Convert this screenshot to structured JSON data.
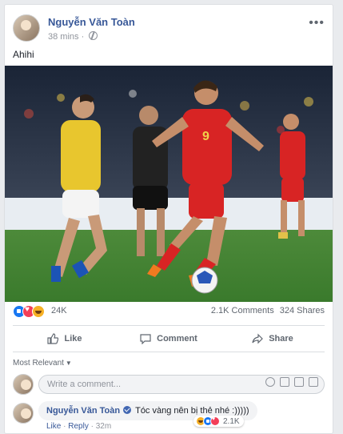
{
  "post": {
    "author": "Nguyễn Văn Toàn",
    "time": "38 mins",
    "separator": "·",
    "text": "Ahihi",
    "more": "•••"
  },
  "stats": {
    "reactions_count": "24K",
    "comments": "2.1K Comments",
    "shares": "324 Shares"
  },
  "actions": {
    "like": "Like",
    "comment": "Comment",
    "share": "Share"
  },
  "comments_section": {
    "sort": "Most Relevant",
    "placeholder": "Write a comment...",
    "items": [
      {
        "author": "Nguyễn Văn Toàn",
        "text": "Tóc vàng nên bị thẻ nhé :)))))",
        "like": "Like",
        "reply": "Reply",
        "sep": "·",
        "time": "32m",
        "reactions": "2.1K"
      }
    ]
  },
  "colors": {
    "brand": "#385898",
    "like": "#1877f2",
    "love": "#f33e58",
    "haha": "#f7b125"
  }
}
